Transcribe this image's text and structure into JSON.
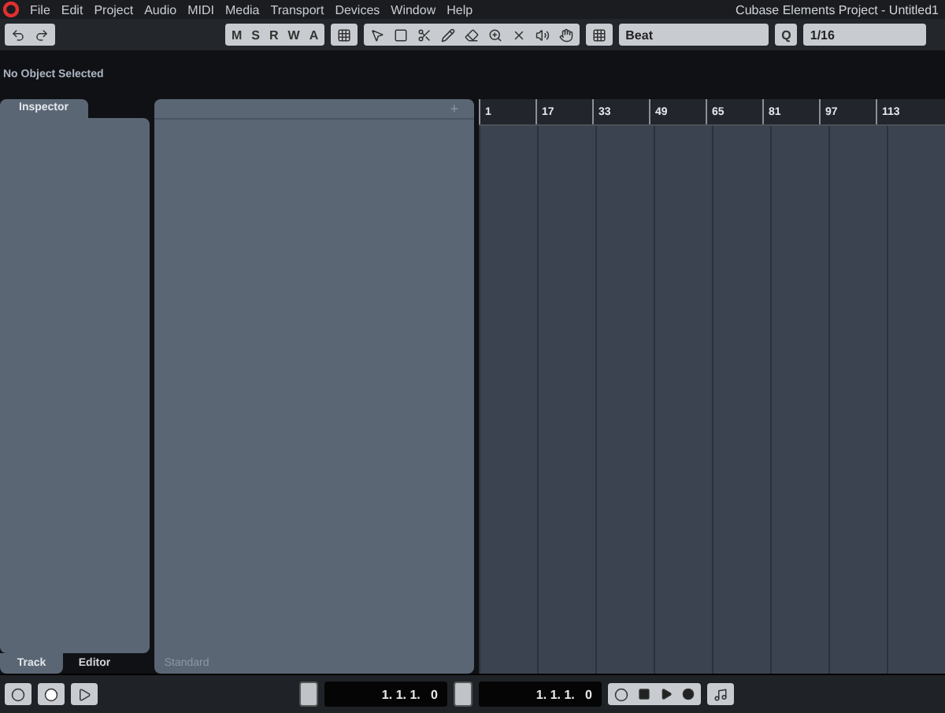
{
  "menu_bar": {
    "items": [
      "File",
      "Edit",
      "Project",
      "Audio",
      "MIDI",
      "Media",
      "Transport",
      "Devices",
      "Window",
      "Help"
    ],
    "title": "Cubase Elements Project - Untitled1"
  },
  "toolbar": {
    "state_buttons": [
      "M",
      "S",
      "R",
      "W",
      "A"
    ],
    "snap_type": "Beat",
    "quantize_label": "Q",
    "quantize_value": "1/16"
  },
  "info_line": "No Object Selected",
  "inspector": {
    "title": "Inspector",
    "tabs": [
      {
        "label": "Track",
        "selected": true
      },
      {
        "label": "Editor",
        "selected": false
      }
    ]
  },
  "track_list": {
    "add_symbol": "+",
    "footer": "Standard"
  },
  "ruler": {
    "marks": [
      "1",
      "17",
      "33",
      "49",
      "65",
      "81",
      "97",
      "113"
    ]
  },
  "transport": {
    "left_locator": "1. 1. 1.   0",
    "right_locator": "1. 1. 1.   0"
  }
}
